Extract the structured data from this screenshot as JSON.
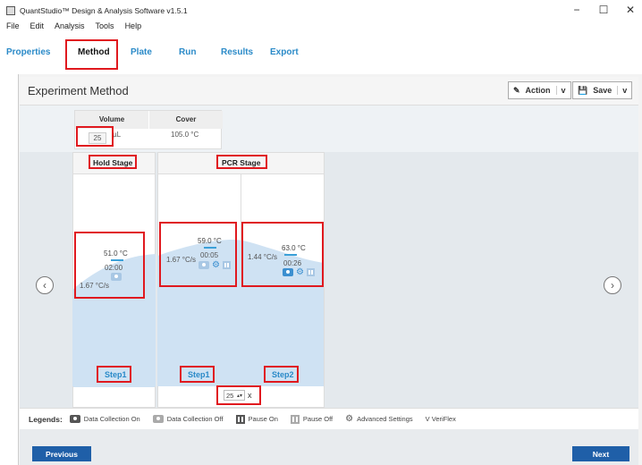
{
  "window": {
    "title": "QuantStudio™ Design & Analysis Software v1.5.1",
    "minimize": "−",
    "maximize": "☐",
    "close": "✕"
  },
  "menu": [
    "File",
    "Edit",
    "Analysis",
    "Tools",
    "Help"
  ],
  "tabs": [
    {
      "label": "Properties",
      "active": false
    },
    {
      "label": "Method",
      "active": true
    },
    {
      "label": "Plate",
      "active": false
    },
    {
      "label": "Run",
      "active": false
    },
    {
      "label": "Results",
      "active": false
    },
    {
      "label": "Export",
      "active": false
    }
  ],
  "header": {
    "title": "Experiment Method",
    "action_label": "Action",
    "save_label": "Save",
    "caret": "v"
  },
  "reaction": {
    "volume_label": "Volume",
    "volume_value": "25",
    "volume_unit": "µL",
    "cover_label": "Cover",
    "cover_value": "105.0 °C"
  },
  "stages": {
    "hold": {
      "label": "Hold Stage",
      "steps": [
        {
          "label": "Step1",
          "temperature": "51.0 °C",
          "time": "02:00",
          "ramp": "1.67 °C/s"
        }
      ]
    },
    "pcr": {
      "label": "PCR Stage",
      "cycles": "25",
      "cycles_suffix": "x",
      "steps": [
        {
          "label": "Step1",
          "temperature": "59.0 °C",
          "time": "00:05",
          "ramp": "1.67 °C/s"
        },
        {
          "label": "Step2",
          "temperature": "63.0 °C",
          "time": "00:26",
          "ramp": "1.44 °C/s"
        }
      ]
    }
  },
  "legend": {
    "title": "Legends:",
    "items": [
      "Data Collection On",
      "Data Collection Off",
      "Pause On",
      "Pause Off",
      "Advanced Settings",
      "V VeriFlex"
    ]
  },
  "footer": {
    "previous_label": "Previous",
    "next_label": "Next"
  },
  "colors": {
    "accent": "#2a8ac8",
    "highlight": "#e0191f",
    "primary_button": "#1f5fa8",
    "profile_fill": "#cfe2f3"
  }
}
